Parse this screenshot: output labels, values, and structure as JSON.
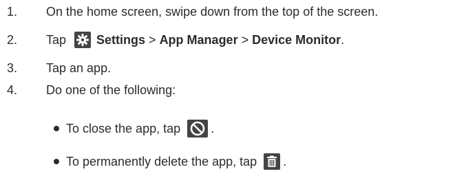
{
  "steps": [
    {
      "number": "1.",
      "text": "On the home screen, swipe down from the top of the screen."
    },
    {
      "number": "2.",
      "prefix": "Tap",
      "item1": "Settings",
      "separator": ">",
      "item2": "App Manager",
      "item3": "Device Monitor",
      "suffix": "."
    },
    {
      "number": "3.",
      "text": "Tap an app."
    },
    {
      "number": "4.",
      "text": "Do one of the following:"
    }
  ],
  "bullets": [
    {
      "text": "To close the app, tap",
      "suffix": "."
    },
    {
      "text": "To permanently delete the app, tap",
      "suffix": "."
    }
  ],
  "icons": {
    "settings": "gear-icon",
    "close": "no-entry-icon",
    "delete": "trash-icon"
  }
}
